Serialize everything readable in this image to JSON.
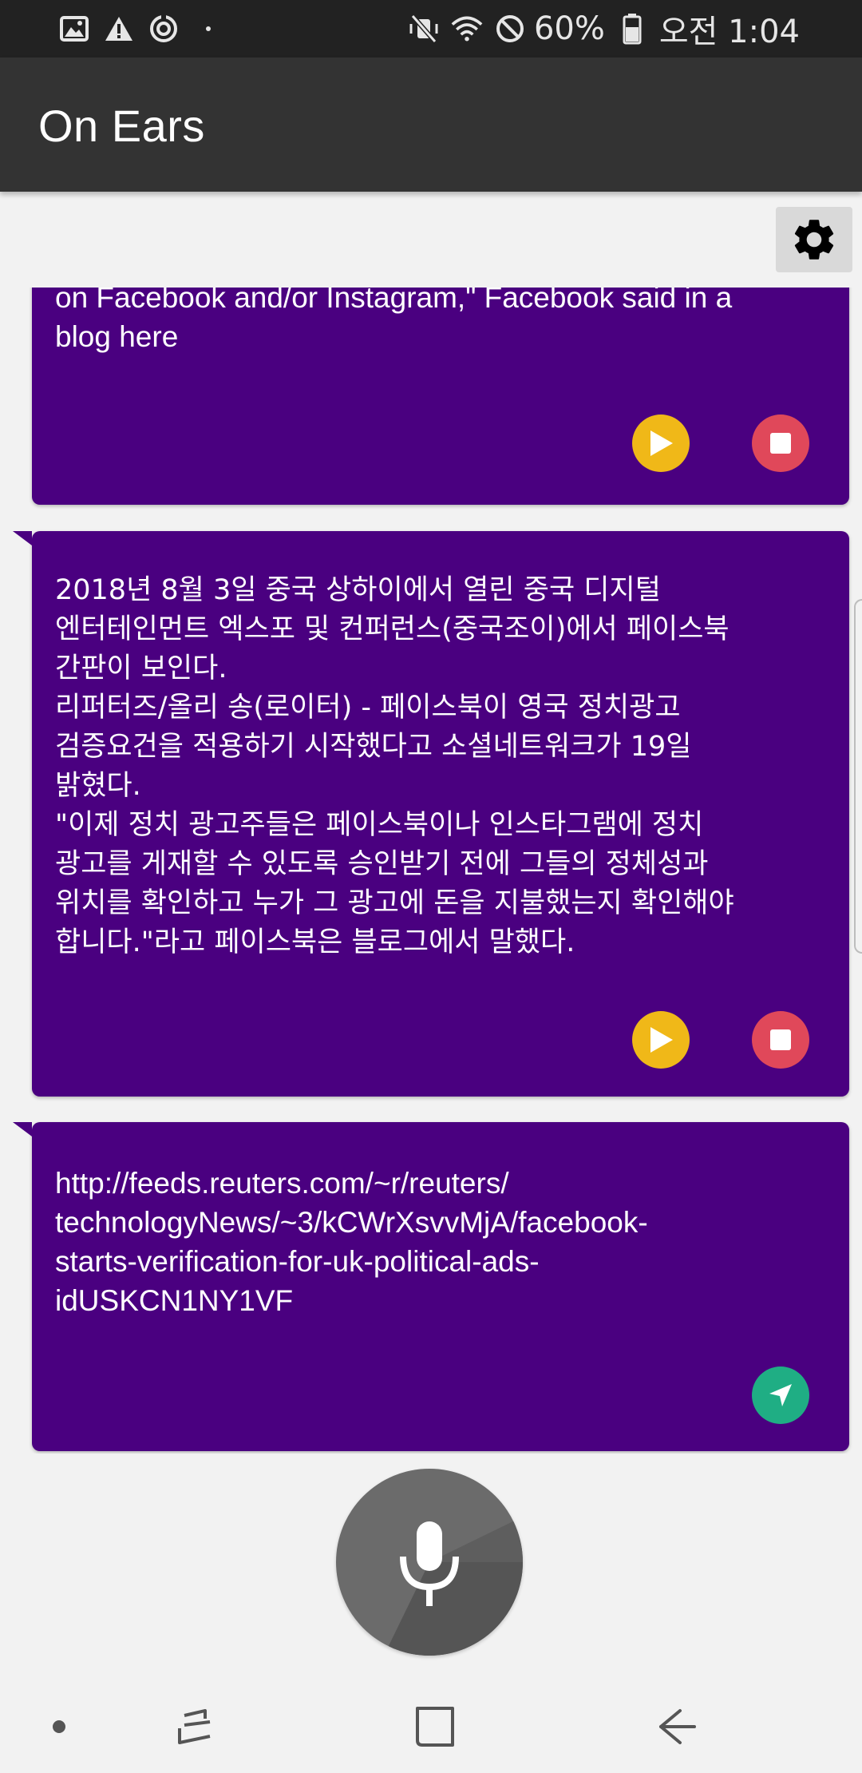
{
  "status_bar": {
    "icons_left": [
      "image-icon",
      "warning-icon",
      "sync-icon",
      "dot-icon"
    ],
    "icons_right": [
      "vibrate-mute-icon",
      "wifi-icon",
      "block-icon",
      "battery-icon"
    ],
    "battery_percent": "60%",
    "clock": "오전 1:04"
  },
  "app_bar": {
    "title": "On Ears",
    "background": "#333333"
  },
  "settings": {
    "icon": "gear-icon"
  },
  "cards": [
    {
      "text": "on Facebook and/or Instagram,\" Facebook said in a\nblog here",
      "actions": [
        "play",
        "stop"
      ]
    },
    {
      "text": "2018년 8월 3일 중국 상하이에서 열린 중국 디지털\n엔터테인먼트 엑스포 및 컨퍼런스(중국조이)에서 페이스북\n간판이 보인다.\n리퍼터즈/올리 송(로이터) - 페이스북이 영국 정치광고\n검증요건을 적용하기 시작했다고 소셜네트워크가 19일\n밝혔다.\n\"이제 정치 광고주들은 페이스북이나 인스타그램에 정치\n광고를 게재할 수 있도록 승인받기 전에 그들의 정체성과\n위치를 확인하고 누가 그 광고에 돈을 지불했는지 확인해야\n합니다.\"라고 페이스북은 블로그에서 말했다.",
      "actions": [
        "play",
        "stop"
      ]
    },
    {
      "text": "http://feeds.reuters.com/~r/reuters/\ntechnologyNews/~3/kCWrXsvvMjA/facebook-\nstarts-verification-for-uk-political-ads-\nidUSKCN1NY1VF",
      "actions": [
        "send"
      ]
    }
  ],
  "colors": {
    "card": "#4a0080",
    "play": "#f0b818",
    "stop": "#e0485a",
    "send": "#1fae84",
    "mic": "#6b6b6b"
  },
  "mic": {
    "icon": "microphone-icon"
  },
  "nav_bar": {
    "items": [
      "dot-icon",
      "recent-apps-icon",
      "home-icon",
      "back-icon"
    ]
  }
}
